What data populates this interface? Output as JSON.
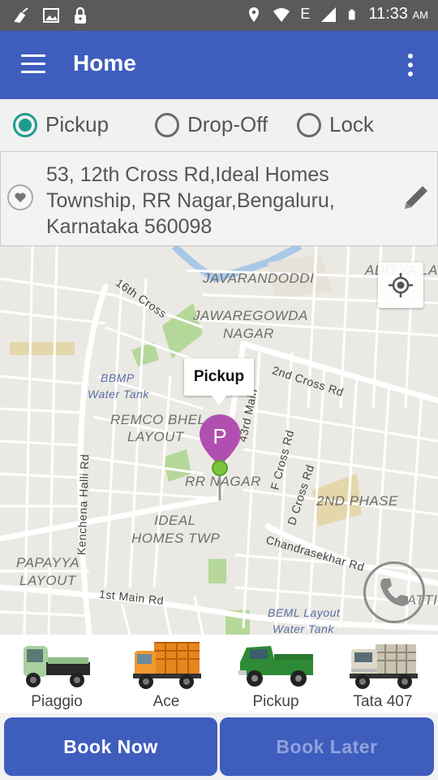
{
  "status_bar": {
    "time": "11:33",
    "ampm": "AM",
    "network": "E"
  },
  "app_bar": {
    "title": "Home"
  },
  "modes": [
    {
      "label": "Pickup",
      "selected": true
    },
    {
      "label": "Drop-Off",
      "selected": false
    },
    {
      "label": "Lock",
      "selected": false
    }
  ],
  "address": {
    "line1": "53, 12th Cross Rd,Ideal Homes",
    "line2": "Township, RR Nagar,Bengaluru,",
    "line3": "Karnataka 560098"
  },
  "map": {
    "pin_label": "Pickup",
    "pin_letter": "P",
    "labels": {
      "javarandoddi": "JAVARANDODDI",
      "aditya": "ADITYA LAY",
      "cross16": "16th Cross",
      "jawaregowda1": "JAWAREGOWDA",
      "jawaregowda2": "NAGAR",
      "bbmp1": "BBMP",
      "bbmp2": "Water Tank",
      "remco1": "REMCO BHEL",
      "remco2": "LAYOUT",
      "cross2": "2nd Cross Rd",
      "main43": "43rd Main",
      "fcross": "F Cross Rd",
      "dcross": "D Cross Rd",
      "rrnagar": "RR NAGAR",
      "phase2": "2ND PHASE",
      "kenchena": "Kenchena Halli Rd",
      "ideal1": "IDEAL",
      "ideal2": "HOMES TWP",
      "chandra": "Chandrasekhar Rd",
      "papayya1": "PAPAYYA",
      "papayya2": "LAYOUT",
      "main1": "1st Main Rd",
      "beml1": "BEML Layout",
      "beml2": "Water Tank",
      "gattige": "GATTIGE"
    }
  },
  "vehicles": [
    {
      "label": "Piaggio",
      "icon": "piaggio-truck-icon"
    },
    {
      "label": "Ace",
      "icon": "ace-truck-icon"
    },
    {
      "label": "Pickup",
      "icon": "pickup-truck-icon"
    },
    {
      "label": "Tata 407",
      "icon": "tata-407-truck-icon"
    }
  ],
  "buttons": {
    "book_now": "Book Now",
    "book_later": "Book Later"
  },
  "colors": {
    "primary": "#3f5dbd",
    "radio_accent": "#1f9c91",
    "pin": "#b04fb0"
  }
}
